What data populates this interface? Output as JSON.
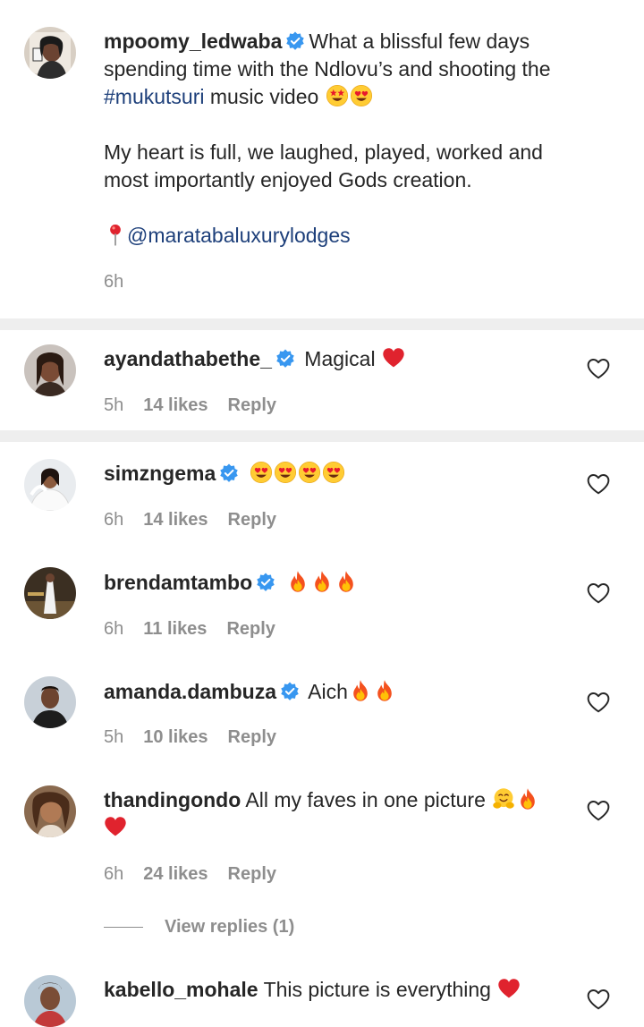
{
  "caption": {
    "username": "mpoomy_ledwaba",
    "text_1": "What a blissful few days spending time with the Ndlovu’s and shooting the ",
    "hashtag": "#mukutsuri",
    "text_2": " music video",
    "paragraph_2": "My heart is full, we laughed, played, worked and most importantly enjoyed Gods creation.",
    "location_emoji": "📍",
    "mention": "@maratabaluxurylodges",
    "time": "6h"
  },
  "comments": [
    {
      "username": "ayandathabethe_",
      "text": "Magical",
      "time": "5h",
      "likes": "14 likes",
      "reply": "Reply"
    },
    {
      "username": "simzngema",
      "text": "",
      "time": "6h",
      "likes": "14 likes",
      "reply": "Reply"
    },
    {
      "username": "brendamtambo",
      "text": "",
      "time": "6h",
      "likes": "11 likes",
      "reply": "Reply"
    },
    {
      "username": "amanda.dambuza",
      "text": "Aich",
      "time": "5h",
      "likes": "10 likes",
      "reply": "Reply"
    },
    {
      "username": "thandingondo",
      "text": "All my faves in one picture",
      "time": "6h",
      "likes": "24 likes",
      "reply": "Reply",
      "view_replies": "View replies (1)"
    },
    {
      "username": "kabello_mohale",
      "text": "This picture is everything"
    }
  ],
  "colors": {
    "link": "#1d3f7a",
    "verified": "#3897f0",
    "secondary_text": "#8e8e8e",
    "divider": "#eeeeee",
    "heart_red": "#e0232e"
  },
  "icons": {
    "verified": "verified-badge-icon",
    "like": "heart-outline-icon",
    "heart_eyes": "heart-eyes-emoji",
    "star_eyes": "star-struck-emoji",
    "fire": "fire-emoji",
    "red_heart": "red-heart-emoji",
    "hug": "hugging-face-emoji",
    "pin": "round-pushpin-emoji"
  }
}
